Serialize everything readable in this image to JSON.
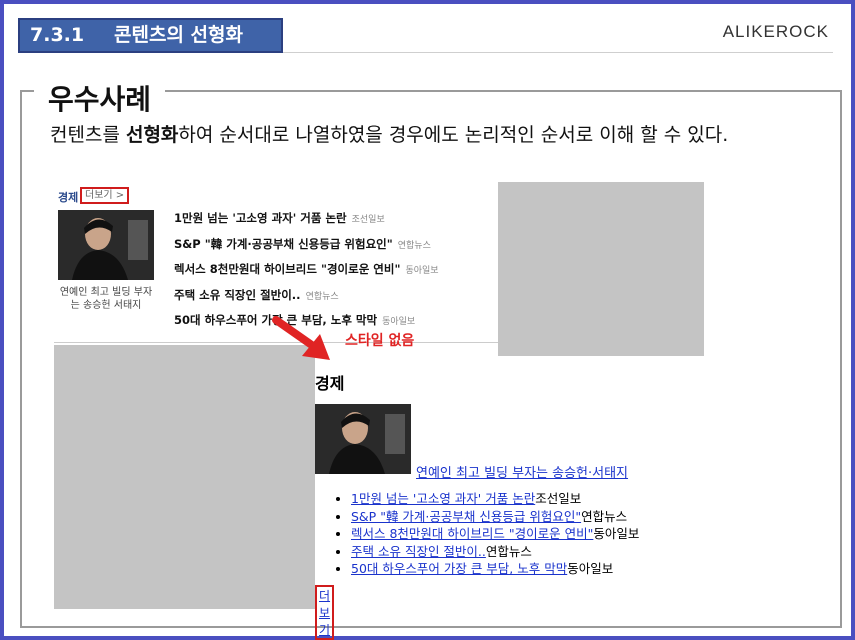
{
  "header": {
    "section_number": "7.3.1",
    "section_title": "콘텐츠의 선형화",
    "brand": "ALIKEROCK"
  },
  "card": {
    "title": "우수사례",
    "desc_pre": "컨텐츠를 ",
    "desc_bold": "선형화",
    "desc_post": "하여 순서대로 나열하였을 경우에도 논리적인 순서로 이해 할 수 있다."
  },
  "styled_box": {
    "category": "경제",
    "more": "더보기 >",
    "caption": "연예인 최고 빌딩 부자는 송승헌 서태지",
    "items": [
      {
        "title": "1만원 넘는 '고소영 과자' 거품 논란",
        "source": "조선일보"
      },
      {
        "title": "S&P \"韓 가계·공공부채 신용등급 위험요인\"",
        "source": "연합뉴스"
      },
      {
        "title": "렉서스 8천만원대 하이브리드 \"경이로운 연비\"",
        "source": "동아일보"
      },
      {
        "title": "주택 소유 직장인 절반이..",
        "source": "연합뉴스"
      },
      {
        "title": "50대 하우스푸어 가장 큰 부담, 노후 막막",
        "source": "동아일보"
      }
    ]
  },
  "annotation": "스타일 없음",
  "plain_box": {
    "category": "경제",
    "caption": "연예인 최고 빌딩 부자는 송승헌·서태지",
    "more": "더보기",
    "items": [
      {
        "title": "1만원 넘는 '고소영 과자' 거품 논란",
        "source": "조선일보"
      },
      {
        "title": "S&P \"韓 가계·공공부채 신용등급 위험요인\"",
        "source": "연합뉴스"
      },
      {
        "title": "렉서스 8천만원대 하이브리드 \"경이로운 연비\"",
        "source": "동아일보"
      },
      {
        "title": "주택 소유 직장인 절반이..",
        "source": "연합뉴스"
      },
      {
        "title": "50대 하우스푸어 가장 큰 부담, 노후 막막",
        "source": "동아일보"
      }
    ]
  },
  "colors": {
    "border": "#4a4fc0",
    "tab": "#3f63a8",
    "highlight": "#d01c1c",
    "link": "#1a33cc"
  }
}
